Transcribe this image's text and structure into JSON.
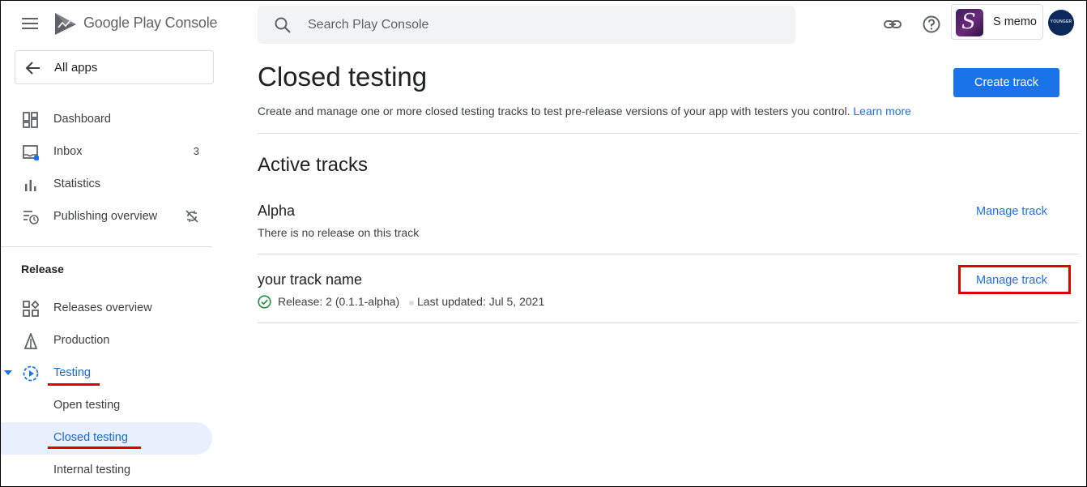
{
  "app": {
    "brand_google": "Google",
    "brand_rest": " Play Console"
  },
  "sidebar": {
    "all_apps": "All apps",
    "items": [
      {
        "label": "Dashboard",
        "icon": "dashboard-icon"
      },
      {
        "label": "Inbox",
        "icon": "inbox-icon",
        "count": "3"
      },
      {
        "label": "Statistics",
        "icon": "bar-chart-icon"
      },
      {
        "label": "Publishing overview",
        "icon": "publishing-icon",
        "trail_icon": "sync-disabled-icon"
      }
    ],
    "section_release": "Release",
    "release_items": [
      {
        "label": "Releases overview",
        "icon": "releases-icon"
      },
      {
        "label": "Production",
        "icon": "production-icon"
      },
      {
        "label": "Testing",
        "icon": "testing-icon"
      }
    ],
    "testing_sub": [
      {
        "label": "Open testing"
      },
      {
        "label": "Closed testing",
        "active": true
      },
      {
        "label": "Internal testing"
      }
    ]
  },
  "topbar": {
    "search_placeholder": "Search Play Console",
    "app_name": "S memo",
    "app_icon_letter": "S",
    "avatar_text": "YOUNGER"
  },
  "main": {
    "title": "Closed testing",
    "create_button": "Create track",
    "description": "Create and manage one or more closed testing tracks to test pre-release versions of your app with testers you control.",
    "learn_more": "Learn more",
    "section_title": "Active tracks",
    "tracks": [
      {
        "name": "Alpha",
        "status": "There is no release on this track",
        "action": "Manage track"
      },
      {
        "name": "your track name",
        "release": "Release: 2 (0.1.1-alpha)",
        "updated": "Last updated: Jul 5, 2021",
        "action": "Manage track"
      }
    ]
  },
  "colors": {
    "accent": "#1a73e8",
    "highlight": "#e00000",
    "active_bg": "#e8f0fe",
    "success": "#1e8e3e"
  }
}
